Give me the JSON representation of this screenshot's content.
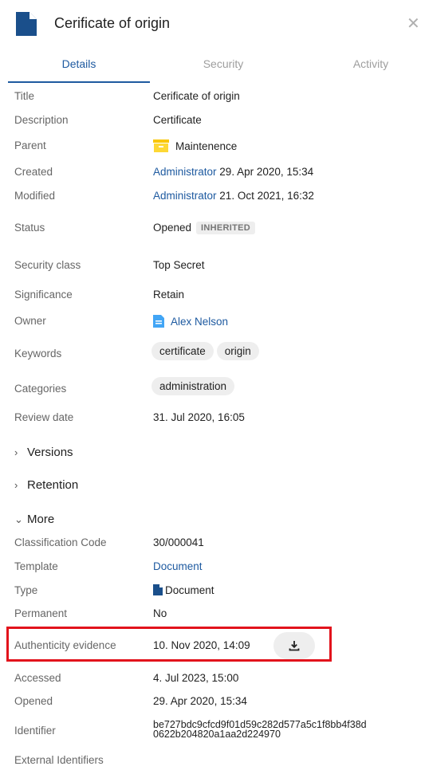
{
  "header": {
    "title": "Cerificate of origin",
    "icon": "document-icon",
    "close_icon": "close-icon"
  },
  "tabs": [
    "Details",
    "Security",
    "Activity"
  ],
  "fields": {
    "title": {
      "label": "Title",
      "value": "Cerificate of origin"
    },
    "description": {
      "label": "Description",
      "value": "Certificate"
    },
    "parent": {
      "label": "Parent",
      "value": "Maintenence",
      "icon": "box-folder-icon",
      "icon_color": "#fdd835"
    },
    "created": {
      "label": "Created",
      "user": "Administrator",
      "date": "29. Apr 2020, 15:34"
    },
    "modified": {
      "label": "Modified",
      "user": "Administrator",
      "date": "21. Oct 2021, 16:32"
    },
    "status": {
      "label": "Status",
      "value": "Opened",
      "badge": "INHERITED"
    },
    "security_class": {
      "label": "Security class",
      "value": "Top Secret"
    },
    "significance": {
      "label": "Significance",
      "value": "Retain"
    },
    "owner": {
      "label": "Owner",
      "value": "Alex Nelson"
    },
    "keywords": {
      "label": "Keywords",
      "chips": [
        "certificate",
        "origin"
      ]
    },
    "categories": {
      "label": "Categories",
      "chips": [
        "administration"
      ]
    },
    "review_date": {
      "label": "Review date",
      "value": "31. Jul 2020, 16:05"
    }
  },
  "sections": {
    "versions": "Versions",
    "retention": "Retention",
    "more": "More"
  },
  "more": {
    "classification_code": {
      "label": "Classification Code",
      "value": "30/000041"
    },
    "template": {
      "label": "Template",
      "value": "Document"
    },
    "type": {
      "label": "Type",
      "value": "Document"
    },
    "permanent": {
      "label": "Permanent",
      "value": "No"
    },
    "authenticity": {
      "label": "Authenticity evidence",
      "value": "10. Nov 2020, 14:09",
      "button_icon": "download-icon"
    },
    "accessed": {
      "label": "Accessed",
      "value": "4. Jul 2023, 15:00"
    },
    "opened": {
      "label": "Opened",
      "value": "29. Apr 2020, 15:34"
    },
    "identifier": {
      "label": "Identifier",
      "line1": "be727bdc9cfcd9f01d59c282d577a5c1f8bb4f38d",
      "line2": "0622b204820a1aa2d224970"
    },
    "external_identifiers": {
      "label": "External Identifiers"
    }
  },
  "colors": {
    "accent": "#1e5aa0",
    "highlight": "#e2131c"
  }
}
